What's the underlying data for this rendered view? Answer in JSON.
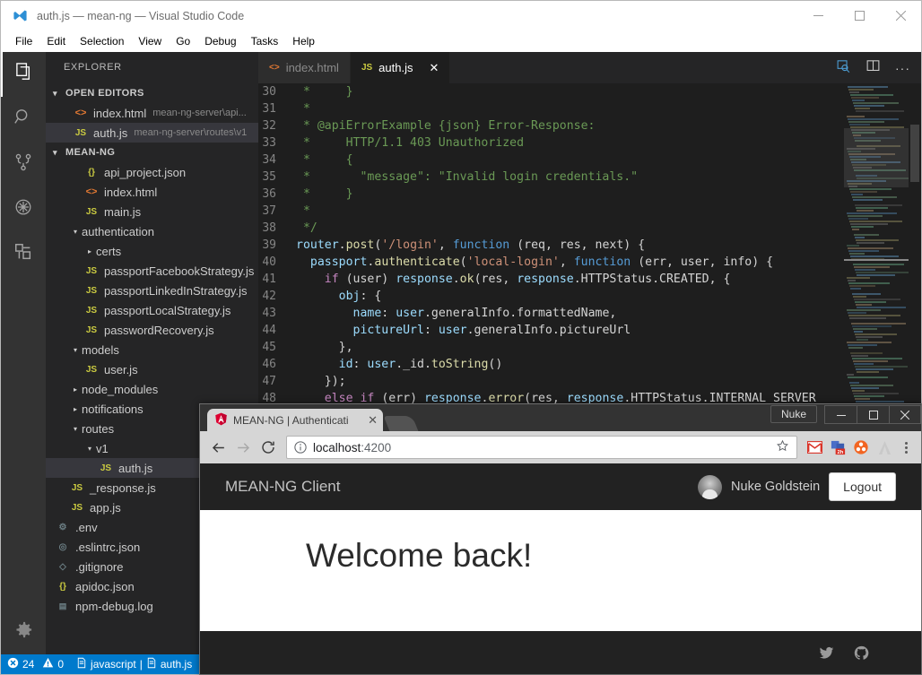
{
  "vscode": {
    "title": "auth.js — mean-ng — Visual Studio Code",
    "window_controls": {
      "minimize": "—",
      "maximize": "☐",
      "close": "✕"
    },
    "menu": [
      "File",
      "Edit",
      "Selection",
      "View",
      "Go",
      "Debug",
      "Tasks",
      "Help"
    ],
    "activitybar": [
      {
        "name": "explorer",
        "icon": "files-icon"
      },
      {
        "name": "search",
        "icon": "search-icon"
      },
      {
        "name": "source-control",
        "icon": "source-control-icon"
      },
      {
        "name": "debug",
        "icon": "debug-icon"
      },
      {
        "name": "extensions",
        "icon": "extensions-icon"
      },
      {
        "name": "settings",
        "icon": "gear-icon"
      }
    ],
    "sidebar": {
      "title": "EXPLORER",
      "open_editors": {
        "label": "OPEN EDITORS",
        "items": [
          {
            "name": "index.html",
            "desc": "mean-ng-server\\api...",
            "icon": "html",
            "selected": false
          },
          {
            "name": "auth.js",
            "desc": "mean-ng-server\\routes\\v1",
            "icon": "js",
            "selected": true
          }
        ]
      },
      "project": {
        "label": "MEAN-NG",
        "tree": [
          {
            "name": "api_project.json",
            "icon": "json",
            "type": "file",
            "depth": 2,
            "selected": false
          },
          {
            "name": "index.html",
            "icon": "html",
            "type": "file",
            "depth": 2,
            "selected": false
          },
          {
            "name": "main.js",
            "icon": "js",
            "type": "file",
            "depth": 2,
            "selected": false
          },
          {
            "name": "authentication",
            "icon": "folder",
            "type": "folder-open",
            "depth": 1,
            "selected": false
          },
          {
            "name": "certs",
            "icon": "folder",
            "type": "folder-closed",
            "depth": 2,
            "selected": false
          },
          {
            "name": "passportFacebookStrategy.js",
            "icon": "js",
            "type": "file",
            "depth": 2,
            "selected": false
          },
          {
            "name": "passportLinkedInStrategy.js",
            "icon": "js",
            "type": "file",
            "depth": 2,
            "selected": false
          },
          {
            "name": "passportLocalStrategy.js",
            "icon": "js",
            "type": "file",
            "depth": 2,
            "selected": false
          },
          {
            "name": "passwordRecovery.js",
            "icon": "js",
            "type": "file",
            "depth": 2,
            "selected": false
          },
          {
            "name": "models",
            "icon": "folder",
            "type": "folder-open",
            "depth": 1,
            "selected": false
          },
          {
            "name": "user.js",
            "icon": "js",
            "type": "file",
            "depth": 2,
            "selected": false
          },
          {
            "name": "node_modules",
            "icon": "folder",
            "type": "folder-closed",
            "depth": 1,
            "selected": false
          },
          {
            "name": "notifications",
            "icon": "folder",
            "type": "folder-closed",
            "depth": 1,
            "selected": false
          },
          {
            "name": "routes",
            "icon": "folder",
            "type": "folder-open",
            "depth": 1,
            "selected": false
          },
          {
            "name": "v1",
            "icon": "folder",
            "type": "folder-open",
            "depth": 2,
            "selected": false
          },
          {
            "name": "auth.js",
            "icon": "js",
            "type": "file",
            "depth": 3,
            "selected": true
          },
          {
            "name": "_response.js",
            "icon": "js",
            "type": "file",
            "depth": 1,
            "selected": false
          },
          {
            "name": "app.js",
            "icon": "js",
            "type": "file",
            "depth": 1,
            "selected": false
          },
          {
            "name": ".env",
            "icon": "gear",
            "type": "file",
            "depth": 0,
            "selected": false
          },
          {
            "name": ".eslintrc.json",
            "icon": "eslint",
            "type": "file",
            "depth": 0,
            "selected": false
          },
          {
            "name": ".gitignore",
            "icon": "git",
            "type": "file",
            "depth": 0,
            "selected": false
          },
          {
            "name": "apidoc.json",
            "icon": "json",
            "type": "file",
            "depth": 0,
            "selected": false
          },
          {
            "name": "npm-debug.log",
            "icon": "log",
            "type": "file",
            "depth": 0,
            "selected": false
          }
        ]
      }
    },
    "tabs": [
      {
        "label": "index.html",
        "icon": "html",
        "active": false,
        "closable": false
      },
      {
        "label": "auth.js",
        "icon": "js",
        "active": true,
        "closable": true,
        "close": "✕"
      }
    ],
    "tab_actions": [
      {
        "name": "open-preview-icon"
      },
      {
        "name": "split-editor-icon"
      },
      {
        "name": "more-actions-icon",
        "label": "···"
      }
    ],
    "code": {
      "language": "javascript",
      "first_line": 30,
      "lines": [
        {
          "n": 30,
          "segments": [
            {
              "t": " *     }",
              "c": "c-comment"
            }
          ]
        },
        {
          "n": 31,
          "segments": [
            {
              "t": " *",
              "c": "c-comment"
            }
          ]
        },
        {
          "n": 32,
          "segments": [
            {
              "t": " * @apiErrorExample {json} Error-Response:",
              "c": "c-comment"
            }
          ]
        },
        {
          "n": 33,
          "segments": [
            {
              "t": " *     HTTP/1.1 403 Unauthorized",
              "c": "c-comment"
            }
          ]
        },
        {
          "n": 34,
          "segments": [
            {
              "t": " *     {",
              "c": "c-comment"
            }
          ]
        },
        {
          "n": 35,
          "segments": [
            {
              "t": " *       \"message\": \"Invalid login credentials.\"",
              "c": "c-comment"
            }
          ]
        },
        {
          "n": 36,
          "segments": [
            {
              "t": " *     }",
              "c": "c-comment"
            }
          ]
        },
        {
          "n": 37,
          "segments": [
            {
              "t": " *",
              "c": "c-comment"
            }
          ]
        },
        {
          "n": 38,
          "segments": [
            {
              "t": " */",
              "c": "c-comment"
            }
          ]
        },
        {
          "n": 39,
          "segments": [
            {
              "t": "router",
              "c": "c-var"
            },
            {
              "t": ".",
              "c": "c-plain"
            },
            {
              "t": "post",
              "c": "c-fn"
            },
            {
              "t": "(",
              "c": "c-plain"
            },
            {
              "t": "'/login'",
              "c": "c-str"
            },
            {
              "t": ", ",
              "c": "c-plain"
            },
            {
              "t": "function",
              "c": "c-keyword"
            },
            {
              "t": " (req, res, next) {",
              "c": "c-plain"
            }
          ]
        },
        {
          "n": 40,
          "segments": [
            {
              "t": "  ",
              "c": "c-plain"
            },
            {
              "t": "passport",
              "c": "c-var"
            },
            {
              "t": ".",
              "c": "c-plain"
            },
            {
              "t": "authenticate",
              "c": "c-fn"
            },
            {
              "t": "(",
              "c": "c-plain"
            },
            {
              "t": "'local-login'",
              "c": "c-str"
            },
            {
              "t": ", ",
              "c": "c-plain"
            },
            {
              "t": "function",
              "c": "c-keyword"
            },
            {
              "t": " (err, user, info) {",
              "c": "c-plain"
            }
          ]
        },
        {
          "n": 41,
          "segments": [
            {
              "t": "    ",
              "c": "c-plain"
            },
            {
              "t": "if",
              "c": "c-ctrl"
            },
            {
              "t": " (user) ",
              "c": "c-plain"
            },
            {
              "t": "response",
              "c": "c-var"
            },
            {
              "t": ".",
              "c": "c-plain"
            },
            {
              "t": "ok",
              "c": "c-fn"
            },
            {
              "t": "(res, ",
              "c": "c-plain"
            },
            {
              "t": "response",
              "c": "c-var"
            },
            {
              "t": ".HTTPStatus.CREATED, {",
              "c": "c-plain"
            }
          ]
        },
        {
          "n": 42,
          "segments": [
            {
              "t": "      ",
              "c": "c-plain"
            },
            {
              "t": "obj",
              "c": "c-var"
            },
            {
              "t": ": {",
              "c": "c-plain"
            }
          ]
        },
        {
          "n": 43,
          "segments": [
            {
              "t": "        ",
              "c": "c-plain"
            },
            {
              "t": "name",
              "c": "c-var"
            },
            {
              "t": ": ",
              "c": "c-plain"
            },
            {
              "t": "user",
              "c": "c-var"
            },
            {
              "t": ".generalInfo.formattedName,",
              "c": "c-plain"
            }
          ]
        },
        {
          "n": 44,
          "segments": [
            {
              "t": "        ",
              "c": "c-plain"
            },
            {
              "t": "pictureUrl",
              "c": "c-var"
            },
            {
              "t": ": ",
              "c": "c-plain"
            },
            {
              "t": "user",
              "c": "c-var"
            },
            {
              "t": ".generalInfo.pictureUrl",
              "c": "c-plain"
            }
          ]
        },
        {
          "n": 45,
          "segments": [
            {
              "t": "      },",
              "c": "c-plain"
            }
          ]
        },
        {
          "n": 46,
          "segments": [
            {
              "t": "      ",
              "c": "c-plain"
            },
            {
              "t": "id",
              "c": "c-var"
            },
            {
              "t": ": ",
              "c": "c-plain"
            },
            {
              "t": "user",
              "c": "c-var"
            },
            {
              "t": "._id.",
              "c": "c-plain"
            },
            {
              "t": "toString",
              "c": "c-fn"
            },
            {
              "t": "()",
              "c": "c-plain"
            }
          ]
        },
        {
          "n": 47,
          "segments": [
            {
              "t": "    });",
              "c": "c-plain"
            }
          ]
        },
        {
          "n": 48,
          "segments": [
            {
              "t": "    ",
              "c": "c-plain"
            },
            {
              "t": "else",
              "c": "c-ctrl"
            },
            {
              "t": " ",
              "c": "c-plain"
            },
            {
              "t": "if",
              "c": "c-ctrl"
            },
            {
              "t": " (err) ",
              "c": "c-plain"
            },
            {
              "t": "response",
              "c": "c-var"
            },
            {
              "t": ".",
              "c": "c-plain"
            },
            {
              "t": "error",
              "c": "c-fn"
            },
            {
              "t": "(res, ",
              "c": "c-plain"
            },
            {
              "t": "response",
              "c": "c-var"
            },
            {
              "t": ".HTTPStatus.INTERNAL_SERVER",
              "c": "c-plain"
            }
          ]
        }
      ]
    },
    "statusbar": {
      "errors_icon": "error-icon",
      "errors": "24",
      "warnings_icon": "warning-icon",
      "warnings": "0",
      "language_icon": "file-icon",
      "language": "javascript",
      "separator": "|",
      "file_icon": "file-icon",
      "file": "auth.js"
    }
  },
  "chrome": {
    "tab": {
      "title": "MEAN-NG | Authenticati",
      "favicon": "angular-icon",
      "close": "✕"
    },
    "new_tab_label": "",
    "profile_button": "Nuke",
    "window_controls": {
      "minimize": "—",
      "maximize": "☐",
      "close": "✕"
    },
    "nav": {
      "back": "←",
      "forward": "→",
      "reload": "⟳"
    },
    "omnibox": {
      "info_icon": "info-icon",
      "url_scheme": "",
      "url_host": "localhost",
      "url_port": ":4200",
      "url_full": "localhost:4200",
      "star_icon": "star-icon"
    },
    "extensions": [
      {
        "name": "gmail-icon",
        "label": "M",
        "badge": ""
      },
      {
        "name": "pocket-icon",
        "label": "",
        "badge": "2h"
      },
      {
        "name": "orange-circle-icon",
        "label": "",
        "badge": ""
      },
      {
        "name": "adobe-pdf-icon",
        "label": "A",
        "badge": ""
      }
    ],
    "menu_icon": "three-dot-menu-icon"
  },
  "webpage": {
    "header": {
      "brand": "MEAN-NG Client",
      "avatar": "user-avatar",
      "username": "Nuke Goldstein",
      "logout": "Logout"
    },
    "main": {
      "heading": "Welcome back!"
    },
    "footer": {
      "links": [
        {
          "name": "twitter-icon"
        },
        {
          "name": "github-icon"
        }
      ]
    }
  },
  "colors": {
    "vs_accent": "#007acc",
    "vs_sidebar": "#252526",
    "vs_editor": "#1e1e1e",
    "site_dark": "#222222",
    "chrome_toolbar": "#d6d6d6"
  }
}
